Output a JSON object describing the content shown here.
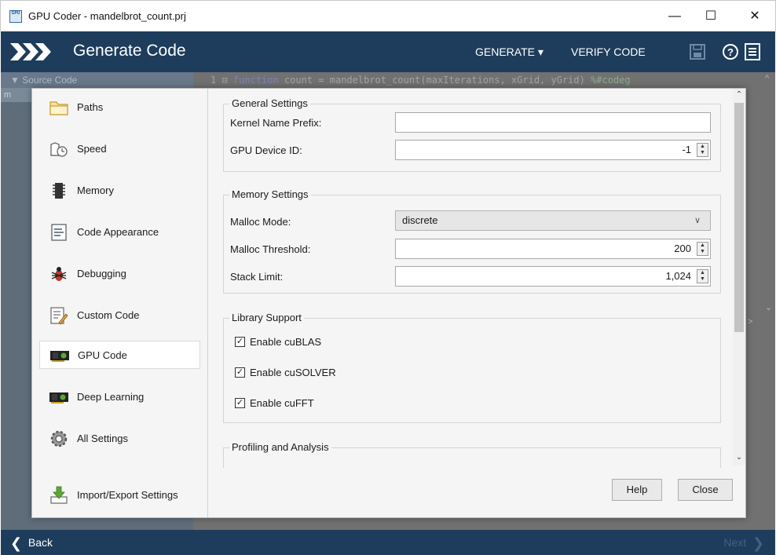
{
  "window": {
    "title": "GPU Coder - mandelbrot_count.prj",
    "app_icon_text": "GPU",
    "minimize": "—",
    "maximize": "☐",
    "close": "✕"
  },
  "topbar": {
    "title": "Generate Code",
    "generate_label": "GENERATE ▾",
    "verify_label": "VERIFY CODE",
    "icons": [
      "save-icon",
      "help-icon",
      "menu-icon"
    ],
    "background_color": "#1e3d5c"
  },
  "background": {
    "source_header": "▼  Source Code",
    "source_item": "m",
    "code_gutter": "1 ⊟",
    "code_keyword": "function",
    "code_rest": " count = mandelbrot_count(maxIterations, xGrid, yGrid) ",
    "code_comment": "%#codeg",
    "right_arrow": ">"
  },
  "sidenav": {
    "items": [
      {
        "label": "Paths",
        "icon": "folder-icon"
      },
      {
        "label": "Speed",
        "icon": "speed-icon"
      },
      {
        "label": "Memory",
        "icon": "memory-chip-icon"
      },
      {
        "label": "Code Appearance",
        "icon": "code-appearance-icon"
      },
      {
        "label": "Debugging",
        "icon": "bug-icon"
      },
      {
        "label": "Custom Code",
        "icon": "custom-code-icon"
      },
      {
        "label": "GPU Code",
        "icon": "gpu-card-icon",
        "active": true
      },
      {
        "label": "Deep Learning",
        "icon": "gpu-card-icon"
      },
      {
        "label": "All Settings",
        "icon": "gear-icon"
      },
      {
        "label": "Import/Export Settings",
        "icon": "import-export-icon"
      }
    ]
  },
  "general": {
    "title": "General Settings",
    "kernel_prefix_label": "Kernel Name Prefix:",
    "kernel_prefix_value": "",
    "device_id_label": "GPU Device ID:",
    "device_id_value": "-1"
  },
  "memory": {
    "title": "Memory Settings",
    "malloc_mode_label": "Malloc Mode:",
    "malloc_mode_value": "discrete",
    "malloc_threshold_label": "Malloc Threshold:",
    "malloc_threshold_value": "200",
    "stack_limit_label": "Stack Limit:",
    "stack_limit_value": "1,024"
  },
  "library": {
    "title": "Library Support",
    "cublas_label": "Enable cuBLAS",
    "cublas_checked": true,
    "cusolver_label": "Enable cuSOLVER",
    "cusolver_checked": true,
    "cufft_label": "Enable cuFFT",
    "cufft_checked": true
  },
  "profiling": {
    "title": "Profiling and Analysis"
  },
  "dialog_buttons": {
    "help": "Help",
    "close": "Close"
  },
  "bottombar": {
    "back_label": "Back",
    "next_label": "Next"
  }
}
